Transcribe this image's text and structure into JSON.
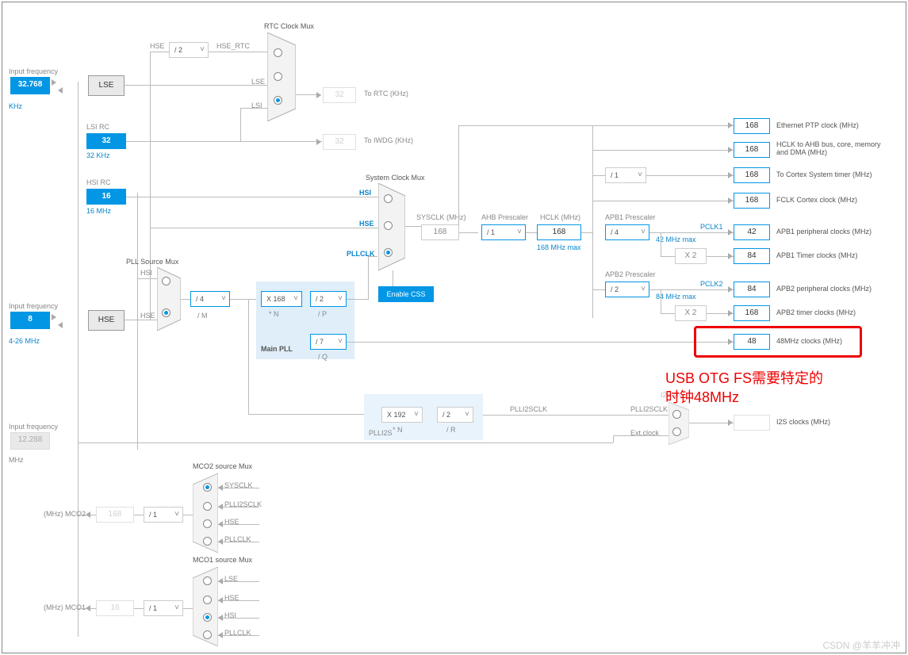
{
  "inputs": {
    "lse": {
      "label": "Input frequency",
      "value": "32.768",
      "unit": "KHz"
    },
    "lsi_rc": {
      "label": "LSI RC",
      "value": "32",
      "unit": "32 KHz"
    },
    "hsi_rc": {
      "label": "HSI RC",
      "value": "16",
      "unit": "16 MHz"
    },
    "hse": {
      "label": "Input frequency",
      "value": "8",
      "unit": "4-26 MHz"
    },
    "i2s": {
      "label": "Input frequency",
      "value": "12.288",
      "unit": "MHz"
    }
  },
  "sources": {
    "lse": "LSE",
    "hse": "HSE"
  },
  "rtc": {
    "title": "RTC Clock Mux",
    "hse_div": "/ 2",
    "hse_lbl": "HSE",
    "hse_rtc": "HSE_RTC",
    "lse_lbl": "LSE",
    "lsi_lbl": "LSI",
    "to_rtc_val": "32",
    "to_rtc_lbl": "To RTC (KHz)",
    "to_iwdg_val": "32",
    "to_iwdg_lbl": "To IWDG (KHz)"
  },
  "pll_src": {
    "title": "PLL Source Mux",
    "hsi": "HSI",
    "hse": "HSE",
    "divM": "/ 4",
    "divM_lbl": "/ M"
  },
  "main_pll": {
    "title": "Main PLL",
    "multN": "X 168",
    "multN_lbl": "* N",
    "divP": "/ 2",
    "divP_lbl": "/ P",
    "divQ": "/ 7",
    "divQ_lbl": "/ Q"
  },
  "plli2s": {
    "title": "PLLI2S",
    "multN": "X 192",
    "multN_lbl": "* N",
    "divR": "/ 2",
    "divR_lbl": "/ R",
    "out_lbl": "PLLI2SCLK"
  },
  "sysclk": {
    "title": "System Clock Mux",
    "hsi": "HSI",
    "hse": "HSE",
    "pllclk": "PLLCLK",
    "css": "Enable CSS",
    "sysclk_lbl": "SYSCLK (MHz)",
    "sysclk_val": "168"
  },
  "ahb": {
    "title": "AHB Prescaler",
    "div": "/ 1",
    "hclk_lbl": "HCLK (MHz)",
    "hclk_val": "168",
    "hclk_max": "168 MHz max"
  },
  "cortex_div": "/ 1",
  "apb1": {
    "title": "APB1 Prescaler",
    "div": "/ 4",
    "pclk_lbl": "PCLK1",
    "pclk_max": "42 MHz max",
    "timer_mult": "X 2"
  },
  "apb2": {
    "title": "APB2 Prescaler",
    "div": "/ 2",
    "pclk_lbl": "PCLK2",
    "pclk_max": "84 MHz max",
    "timer_mult": "X 2"
  },
  "outputs": {
    "eth": {
      "val": "168",
      "lbl": "Ethernet PTP clock (MHz)"
    },
    "hclk": {
      "val": "168",
      "lbl": "HCLK to AHB bus, core, memory and DMA (MHz)"
    },
    "cortex": {
      "val": "168",
      "lbl": "To Cortex System timer (MHz)"
    },
    "fclk": {
      "val": "168",
      "lbl": "FCLK Cortex clock (MHz)"
    },
    "apb1p": {
      "val": "42",
      "lbl": "APB1 peripheral clocks (MHz)"
    },
    "apb1t": {
      "val": "84",
      "lbl": "APB1 Timer clocks (MHz)"
    },
    "apb2p": {
      "val": "84",
      "lbl": "APB2 peripheral clocks (MHz)"
    },
    "apb2t": {
      "val": "168",
      "lbl": "APB2 timer clocks (MHz)"
    },
    "c48": {
      "val": "48",
      "lbl": "48MHz clocks (MHz)"
    },
    "i2s": {
      "val": "",
      "lbl": "I2S clocks (MHz)"
    }
  },
  "i2s_mux": {
    "title": "I2S src",
    "pll_lbl": "PLLI2SCLK",
    "ext_lbl": "Ext.clock"
  },
  "mco2": {
    "title": "MCO2 source Mux",
    "lbl": "(MHz) MCO2",
    "div": "/ 1",
    "val": "168",
    "opts": [
      "SYSCLK",
      "PLLI2SCLK",
      "HSE",
      "PLLCLK"
    ]
  },
  "mco1": {
    "title": "MCO1 source Mux",
    "lbl": "(MHz) MCO1",
    "div": "/ 1",
    "val": "16",
    "opts": [
      "LSE",
      "HSE",
      "HSI",
      "PLLCLK"
    ]
  },
  "annotation": {
    "line1": "USB OTG FS需要特定的",
    "line2": "时钟48MHz"
  },
  "watermark": "CSDN @羊羊冲冲"
}
